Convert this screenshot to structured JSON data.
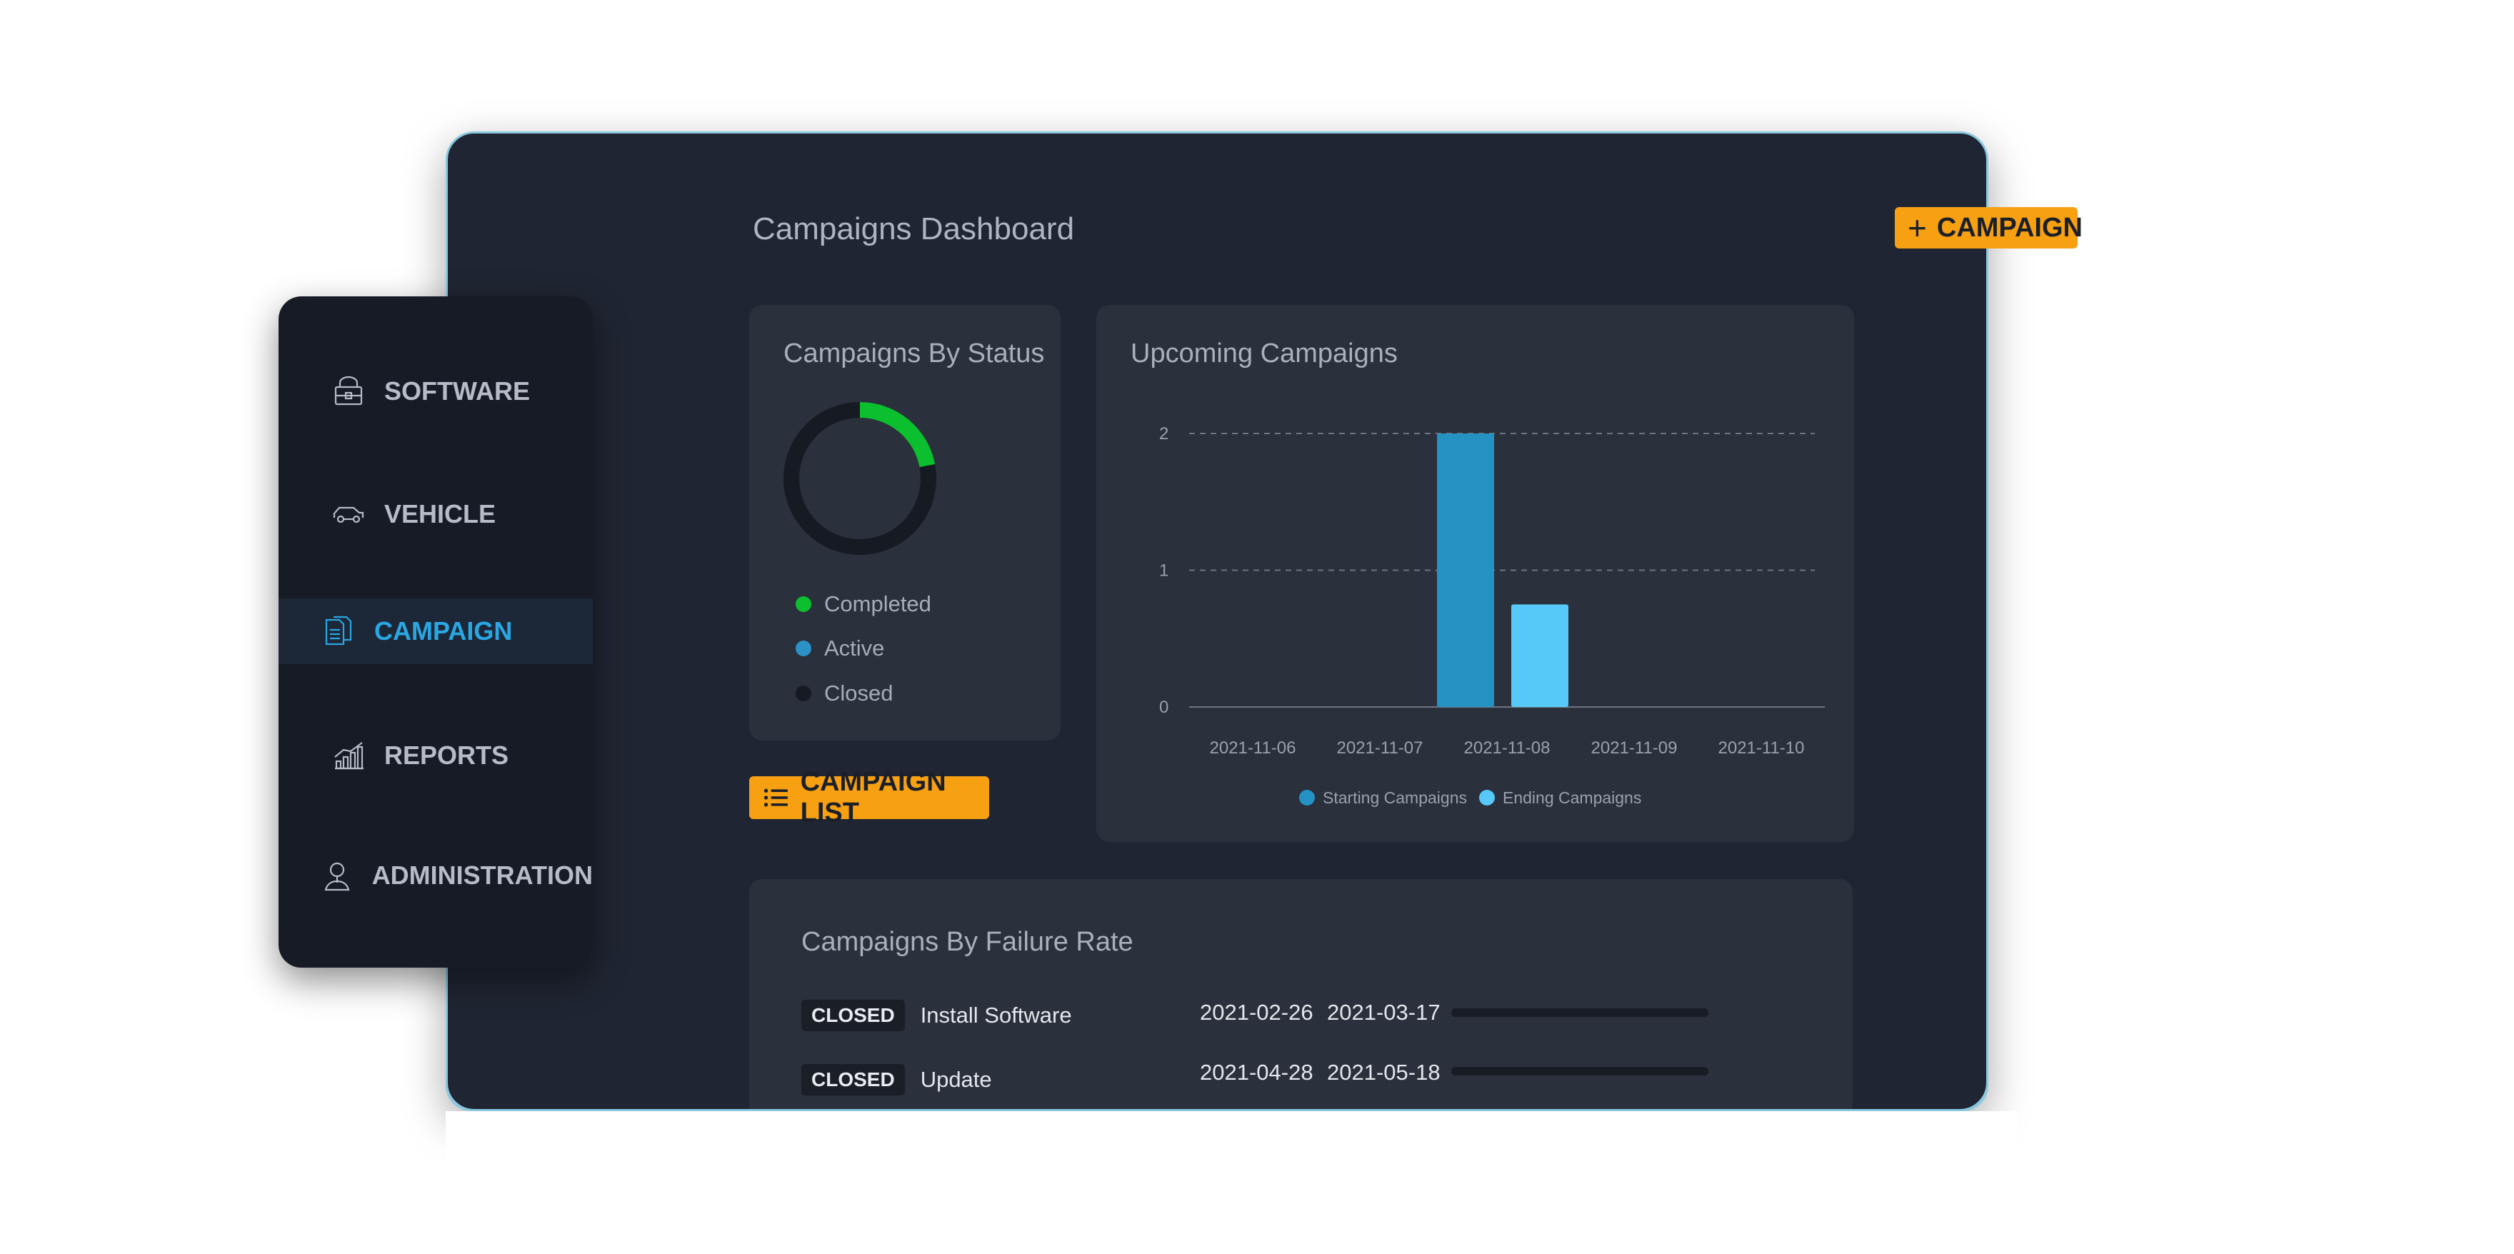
{
  "page": {
    "title": "Campaigns Dashboard",
    "add_campaign_label": "CAMPAIGN",
    "campaign_list_label": "CAMPAIGN LIST"
  },
  "sidebar": {
    "items": [
      {
        "label": "SOFTWARE",
        "icon": "software-package-icon",
        "active": false
      },
      {
        "label": "VEHICLE",
        "icon": "car-icon",
        "active": false
      },
      {
        "label": "CAMPAIGN",
        "icon": "document-copy-icon",
        "active": true
      },
      {
        "label": "REPORTS",
        "icon": "chart-growth-icon",
        "active": false
      },
      {
        "label": "ADMINISTRATION",
        "icon": "user-icon",
        "active": false
      }
    ]
  },
  "status_card": {
    "title": "Campaigns By Status",
    "legend": [
      {
        "label": "Completed",
        "color": "#0cbf2f"
      },
      {
        "label": "Active",
        "color": "#2a92c6"
      },
      {
        "label": "Closed",
        "color": "#161a22"
      }
    ],
    "donut_shares": [
      {
        "label": "Completed",
        "fraction": 0.22
      },
      {
        "label": "Active",
        "fraction": 0.06
      },
      {
        "label": "Closed",
        "fraction": 0.72
      }
    ]
  },
  "upcoming_card": {
    "title": "Upcoming Campaigns"
  },
  "chart_data": {
    "type": "bar",
    "categories": [
      "2021-11-06",
      "2021-11-07",
      "2021-11-08",
      "2021-11-09",
      "2021-11-10"
    ],
    "series": [
      {
        "name": "Starting Campaigns",
        "color": "#2592c4",
        "values": [
          0,
          0,
          2,
          0,
          0
        ]
      },
      {
        "name": "Ending Campaigns",
        "color": "#56c9f8",
        "values": [
          0,
          0,
          0.75,
          0,
          0
        ]
      }
    ],
    "yticks": [
      "0",
      "1",
      "2"
    ],
    "ylim": [
      0,
      2
    ],
    "grid": true,
    "legend_position": "bottom"
  },
  "failure_card": {
    "title": "Campaigns By Failure Rate",
    "rows": [
      {
        "status": "CLOSED",
        "name": "Install Software",
        "start": "2021-02-26",
        "end": "2021-03-17"
      },
      {
        "status": "CLOSED",
        "name": "Update",
        "start": "2021-04-28",
        "end": "2021-05-18"
      }
    ]
  }
}
